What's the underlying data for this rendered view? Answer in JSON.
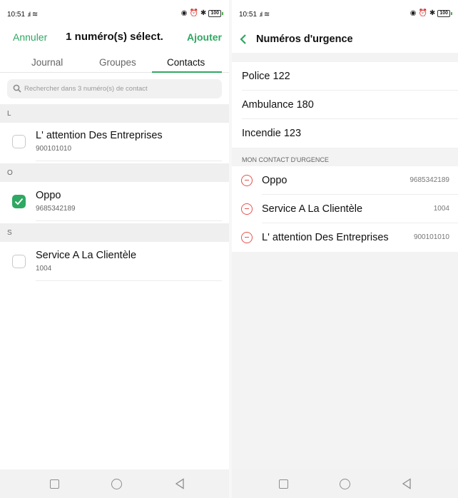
{
  "left": {
    "status": {
      "time": "10:51",
      "signal": ".ıl",
      "battery": "100"
    },
    "header": {
      "cancel": "Annuler",
      "title": "1 numéro(s) sélect.",
      "add": "Ajouter"
    },
    "tabs": [
      "Journal",
      "Groupes",
      "Contacts"
    ],
    "active_tab": "Contacts",
    "search": {
      "placeholder": "Rechercher dans 3 numéro(s) de contact"
    },
    "sections": [
      {
        "letter": "L",
        "contact": {
          "name": "L' attention Des Entreprises",
          "number": "900101010",
          "checked": false
        }
      },
      {
        "letter": "O",
        "contact": {
          "name": "Oppo",
          "number": "9685342189",
          "checked": true
        }
      },
      {
        "letter": "S",
        "contact": {
          "name": "Service A La Clientèle",
          "number": "1004",
          "checked": false
        }
      }
    ]
  },
  "right": {
    "status": {
      "time": "10:51",
      "signal": ".ıl",
      "battery": "100"
    },
    "header": {
      "title": "Numéros d'urgence"
    },
    "emergency": [
      "Police 122",
      "Ambulance 180",
      "Incendie 123"
    ],
    "section_label": "MON CONTACT D'URGENCE",
    "contacts": [
      {
        "name": "Oppo",
        "number": "9685342189"
      },
      {
        "name": "Service A La Clientèle",
        "number": "1004"
      },
      {
        "name": "L' attention Des Entreprises",
        "number": "900101010"
      }
    ]
  },
  "colors": {
    "accent": "#2fa862",
    "remove": "#e8524e"
  },
  "icons": [
    "search-icon",
    "checkmark-icon",
    "back-chevron-icon",
    "remove-icon",
    "wifi-icon",
    "bluetooth-icon",
    "alarm-icon",
    "battery-icon"
  ]
}
